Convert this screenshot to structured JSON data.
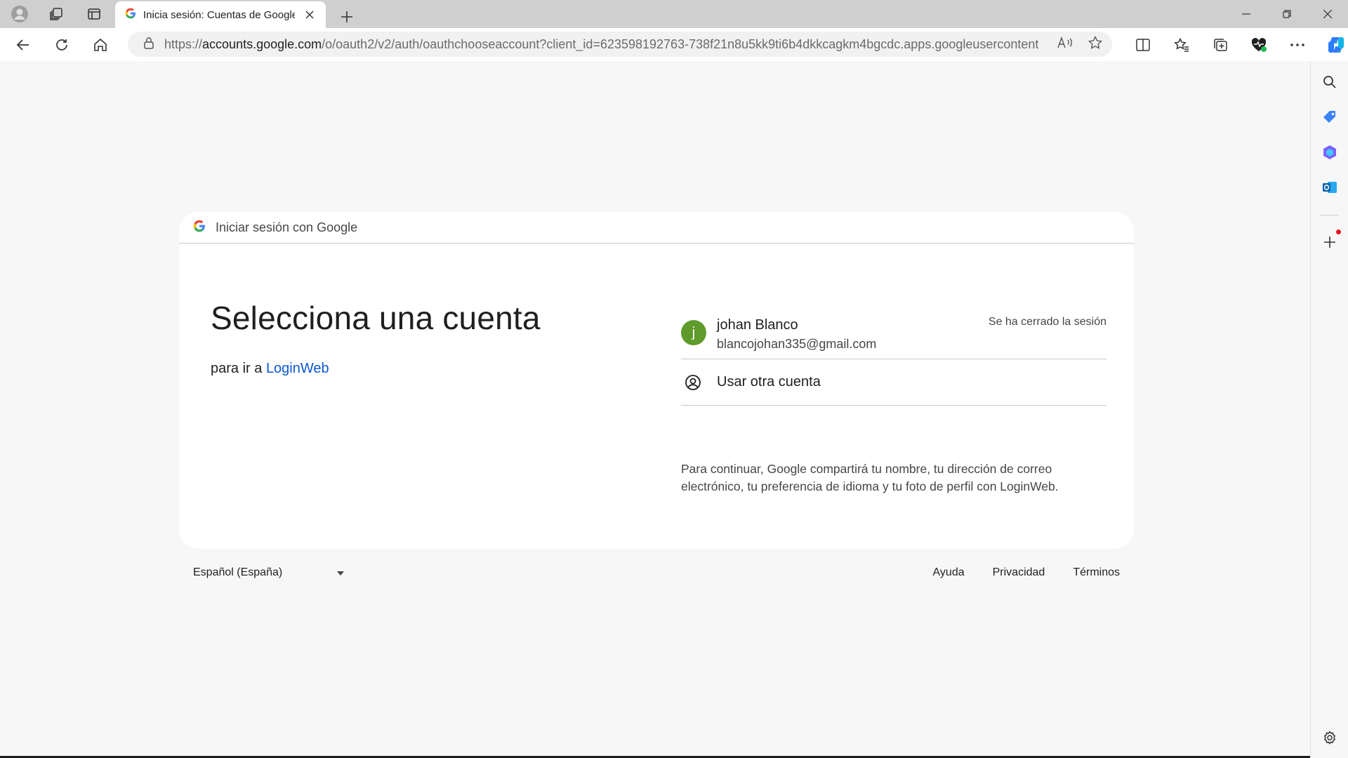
{
  "browser": {
    "tab_title": "Inicia sesión: Cuentas de Google",
    "url_prefix": "https://",
    "url_domain": "accounts.google.com",
    "url_rest": "/o/oauth2/v2/auth/oauthchooseaccount?client_id=623598192763-738f21n8u5kk9ti6b4dkkcagkm4bgcdc.apps.googleusercontent...."
  },
  "card": {
    "header_text": "Iniciar sesión con Google",
    "heading": "Selecciona una cuenta",
    "sub_prefix": "para ir a",
    "app_name": "LoginWeb",
    "account": {
      "initial": "j",
      "name": "johan Blanco",
      "email": "blancojohan335@gmail.com",
      "status": "Se ha cerrado la sesión"
    },
    "other_account": "Usar otra cuenta",
    "disclaimer": "Para continuar, Google compartirá tu nombre, tu dirección de correo electrónico, tu preferencia de idioma y tu foto de perfil con LoginWeb."
  },
  "footer": {
    "language": "Español (España)",
    "links": [
      "Ayuda",
      "Privacidad",
      "Términos"
    ]
  },
  "colors": {
    "link_blue": "#0b57d0",
    "avatar_green": "#5f9b2a",
    "notification_red": "#e81123"
  }
}
